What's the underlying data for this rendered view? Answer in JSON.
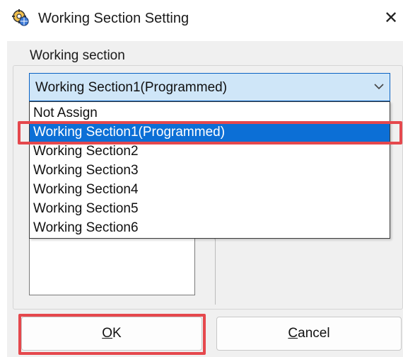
{
  "window": {
    "title": "Working Section Setting",
    "close_glyph": "✕",
    "icon": "gear-globe-icon"
  },
  "group": {
    "label": "Working section"
  },
  "combo": {
    "selected_value": "Working Section1(Programmed)",
    "arrow_icon": "chevron-down-icon"
  },
  "dropdown": {
    "options": [
      "Not Assign",
      "Working Section1(Programmed)",
      "Working Section2",
      "Working Section3",
      "Working Section4",
      "Working Section5",
      "Working Section6"
    ],
    "selected_option": "Working Section1(Programmed)"
  },
  "buttons": {
    "ok": {
      "mnemonic": "O",
      "rest": "K"
    },
    "cancel": {
      "mnemonic": "C",
      "rest": "ancel"
    }
  },
  "colors": {
    "highlight_annotation": "#e5484d",
    "selection": "#0c6fd6",
    "combo_focus_bg": "#cfe6f8"
  }
}
